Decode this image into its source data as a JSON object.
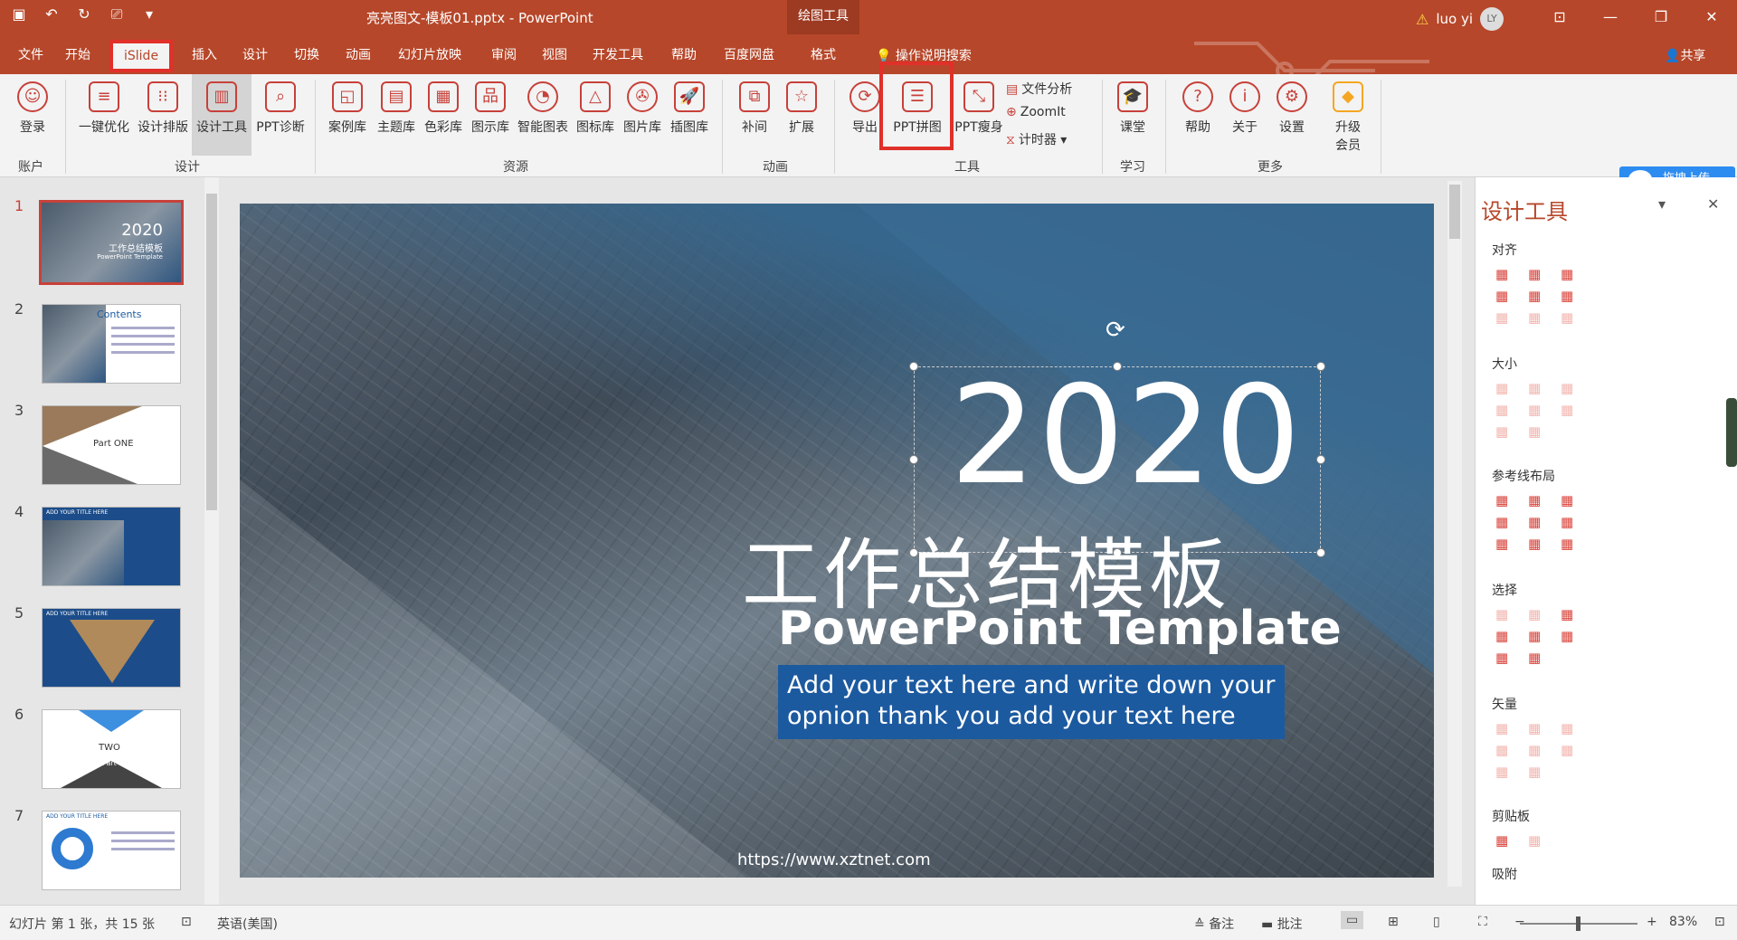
{
  "titlebar": {
    "doc_title": "亮亮图文-模板01.pptx - PowerPoint",
    "context_tool": "绘图工具",
    "user_name": "luo yi",
    "user_initials": "LY"
  },
  "tabs": [
    "文件",
    "开始",
    "iSlide",
    "插入",
    "设计",
    "切换",
    "动画",
    "幻灯片放映",
    "审阅",
    "视图",
    "开发工具",
    "帮助",
    "百度网盘",
    "格式"
  ],
  "active_tab": "iSlide",
  "search_label": "操作说明搜索",
  "share_label": "共享",
  "ribbon": {
    "account": {
      "login": "登录",
      "group": "账户"
    },
    "design": {
      "one_click": "一键优化",
      "layout": "设计排版",
      "tools": "设计工具",
      "diagnose": "PPT诊断",
      "group": "设计"
    },
    "resources": {
      "cases": "案例库",
      "themes": "主题库",
      "colors": "色彩库",
      "diagrams": "图示库",
      "smart_charts": "智能图表",
      "icons": "图标库",
      "images": "图片库",
      "illus": "插图库",
      "group": "资源"
    },
    "animation": {
      "tween": "补间",
      "extend": "扩展",
      "group": "动画"
    },
    "tools": {
      "export": "导出",
      "stitch": "PPT拼图",
      "slim": "PPT瘦身",
      "file_analysis": "文件分析",
      "zoomit": "ZoomIt",
      "timer": "计时器",
      "group": "工具"
    },
    "learn": {
      "course": "课堂",
      "group": "学习"
    },
    "more": {
      "help": "帮助",
      "about": "关于",
      "settings": "设置",
      "upgrade1": "升级",
      "upgrade2": "会员",
      "group": "更多"
    }
  },
  "baidu_upload": "拖拽上传",
  "thumbnails": {
    "numbers": [
      "1",
      "2",
      "3",
      "4",
      "5",
      "6",
      "7"
    ],
    "t1_year": "2020",
    "t1_cn": "工作总结模板",
    "t1_en": "PowerPoint Template",
    "t2_title": "Contents",
    "t3_text": "Part ONE",
    "t4_text": "ADD YOUR TITLE HERE",
    "t5_text": "ADD YOUR TITLE HERE",
    "t6_text": "TWO",
    "t6_sub": "Part",
    "t7_text": "ADD YOUR TITLE HERE"
  },
  "slide": {
    "year": "2020",
    "cn_title": "工作总结模板",
    "en_title": "PowerPoint Template",
    "body": "Add your text here and write down your opnion thank you add your text here",
    "url": "https://www.xztnet.com"
  },
  "design_panel": {
    "title": "设计工具",
    "sections": [
      "对齐",
      "大小",
      "参考线布局",
      "选择",
      "矢量",
      "剪贴板",
      "吸附"
    ]
  },
  "status": {
    "slide_info": "幻灯片 第 1 张，共 15 张",
    "language": "英语(美国)",
    "notes": "备注",
    "comments": "批注",
    "zoom": "83%"
  },
  "colors": {
    "accent": "#b7472a",
    "highlight": "#e0302a",
    "body_box": "#1c5aa0"
  }
}
